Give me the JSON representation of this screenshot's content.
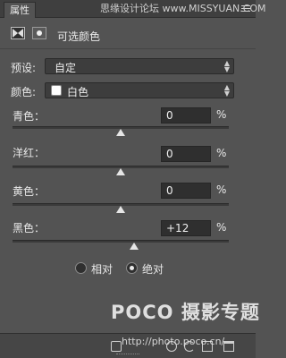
{
  "panel": {
    "tab_label": "属性",
    "title": "可选颜色"
  },
  "watermark": {
    "top_text": "思缘设计论坛 www.MISSYUAN.COM",
    "logo_text": "POCO 摄影专题",
    "url_text": "http://photo.poco.cn/"
  },
  "preset": {
    "label": "预设:",
    "value": "自定"
  },
  "colors": {
    "label": "颜色:",
    "value": "白色",
    "swatch_color": "#ffffff"
  },
  "sliders": [
    {
      "label": "青色：",
      "value": "0",
      "unit": "%",
      "level": 0.5
    },
    {
      "label": "洋红：",
      "value": "0",
      "unit": "%",
      "level": 0.5
    },
    {
      "label": "黄色：",
      "value": "0",
      "unit": "%",
      "level": 0.5
    },
    {
      "label": "黑色：",
      "value": "+12",
      "unit": "%",
      "level": 0.56
    }
  ],
  "method": {
    "options": [
      {
        "label": "相对",
        "selected": false
      },
      {
        "label": "绝对",
        "selected": true
      }
    ]
  },
  "icons": [
    "adjustment-mode-icon",
    "mask-icon",
    "menu-icon",
    "clip-icon",
    "eye-icon",
    "reset-icon",
    "view-icon",
    "trash-icon"
  ]
}
